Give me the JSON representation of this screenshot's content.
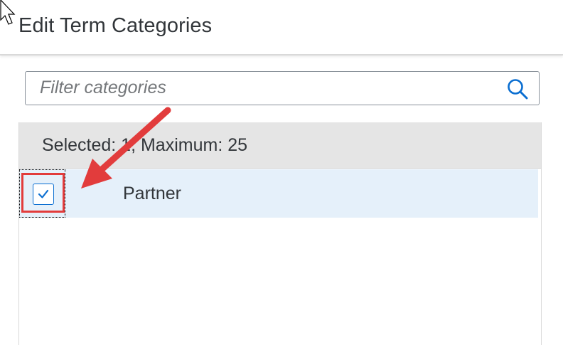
{
  "dialog": {
    "title": "Edit Term Categories"
  },
  "search": {
    "placeholder": "Filter categories",
    "value": ""
  },
  "list": {
    "selected_info": "Selected: 1, Maximum: 25",
    "items": [
      {
        "label": "Partner",
        "checked": true
      }
    ]
  },
  "icons": {
    "cursor": "mouse-pointer-icon",
    "search": "search-icon",
    "checkmark": "checkmark-icon",
    "annotation": "red-arrow-icon"
  },
  "colors": {
    "accent": "#0a6ed1",
    "selected_row": "#e5f0fa",
    "info_bar": "#e5e5e5",
    "annotation_red": "#e23c3c",
    "text": "#32363a"
  }
}
